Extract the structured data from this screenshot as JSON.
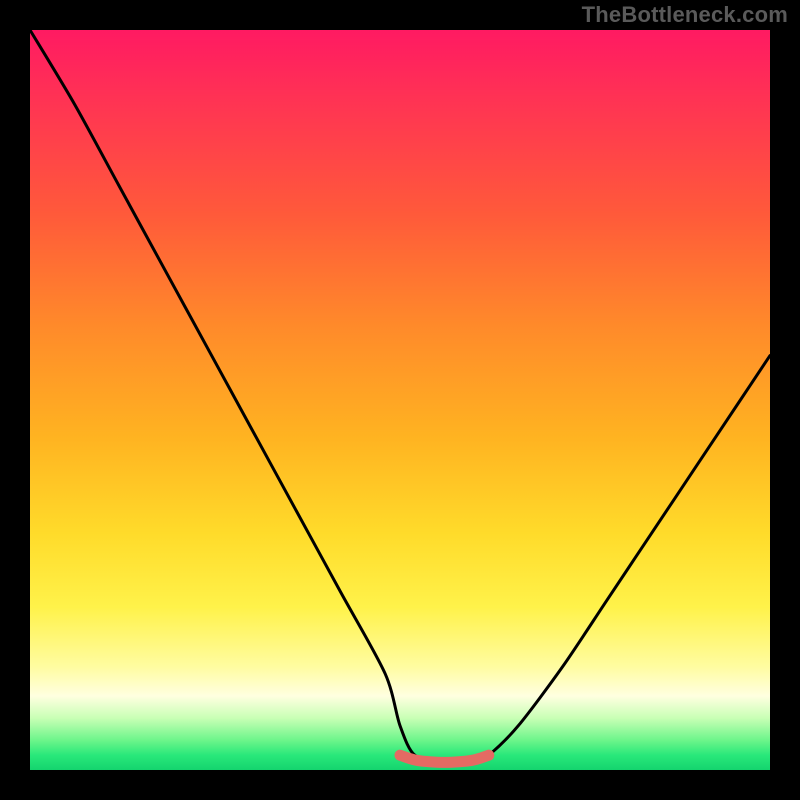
{
  "watermark": "TheBottleneck.com",
  "chart_data": {
    "type": "line",
    "title": "",
    "xlabel": "",
    "ylabel": "",
    "xlim": [
      0,
      100
    ],
    "ylim": [
      0,
      100
    ],
    "series": [
      {
        "name": "bottleneck-curve",
        "x": [
          0,
          6,
          12,
          18,
          24,
          30,
          36,
          42,
          48,
          50,
          52,
          56,
          60,
          62,
          66,
          72,
          78,
          84,
          90,
          96,
          100
        ],
        "values": [
          100,
          90,
          79,
          68,
          57,
          46,
          35,
          24,
          13,
          6,
          2,
          1,
          1,
          2,
          6,
          14,
          23,
          32,
          41,
          50,
          56
        ]
      },
      {
        "name": "optimal-band",
        "x": [
          50,
          52,
          54,
          56,
          58,
          60,
          62
        ],
        "values": [
          2,
          1.3,
          1.1,
          1.0,
          1.1,
          1.3,
          2
        ]
      }
    ],
    "annotations": [],
    "colors": {
      "curve": "#000000",
      "optimal": "#e46a63",
      "gradient_top": "#ff1a62",
      "gradient_mid": "#ffdb2a",
      "gradient_bottom": "#14d46e",
      "background": "#000000",
      "watermark": "#5a5a5a"
    }
  }
}
